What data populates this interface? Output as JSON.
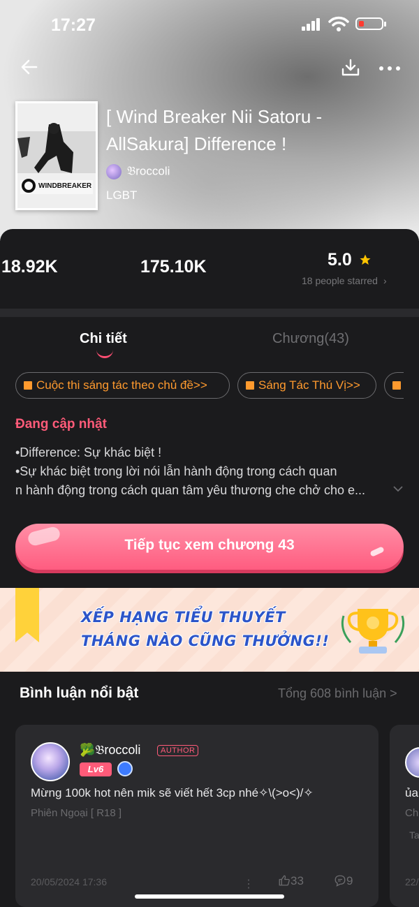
{
  "status": {
    "time": "17:27"
  },
  "book": {
    "title": "[ Wind Breaker Nii Satoru - AllSakura] Difference !",
    "author": "𝔅roccoli",
    "genre": "LGBT",
    "cover_text": "WINDBREAKER"
  },
  "stats": {
    "reads": "18.92K",
    "votes": "175.10K",
    "rating": "5.0",
    "rating_note": "18 people starred"
  },
  "tabs": {
    "details": "Chi tiết",
    "chapters": "Chương(43)"
  },
  "tags": [
    "Cuộc thi sáng tác theo chủ đề>>",
    "Sáng Tác Thú Vị>>"
  ],
  "description": {
    "status": "Đang cập nhật",
    "line1": "•Difference: Sự khác biệt !",
    "line2": "•Sự khác biệt trong lời nói lẫn hành động trong cách quan",
    "line3": "n hành động trong cách quan tâm yêu thương che chở cho e..."
  },
  "cta": {
    "label": "Tiếp tục xem chương 43"
  },
  "banner": {
    "line1": "XẾP HẠNG TIỂU THUYẾT",
    "line2": "THÁNG NÀO CŨNG THƯỞNG!!"
  },
  "comments": {
    "title": "Bình luận nổi bật",
    "total": "Tổng 608 bình luận >",
    "items": [
      {
        "user": "🥦𝔅roccoli",
        "badge": "AUTHOR",
        "level": "Lv6",
        "text": "Mừng 100k hot nên mik sẽ viết hết 3cp nhé✧\\(>o<)/✧",
        "chapter": "Phiên Ngoại [ R18 ]",
        "date": "20/05/2024 17:36",
        "likes": "33",
        "replies": "9"
      }
    ],
    "peek": {
      "text": "ủa",
      "sub1": "Ch",
      "sub2": "Ta",
      "date": "22/"
    }
  },
  "colors": {
    "accent": "#ff5b79",
    "tag": "#ff9a2e",
    "banner_text": "#2c55c9"
  }
}
